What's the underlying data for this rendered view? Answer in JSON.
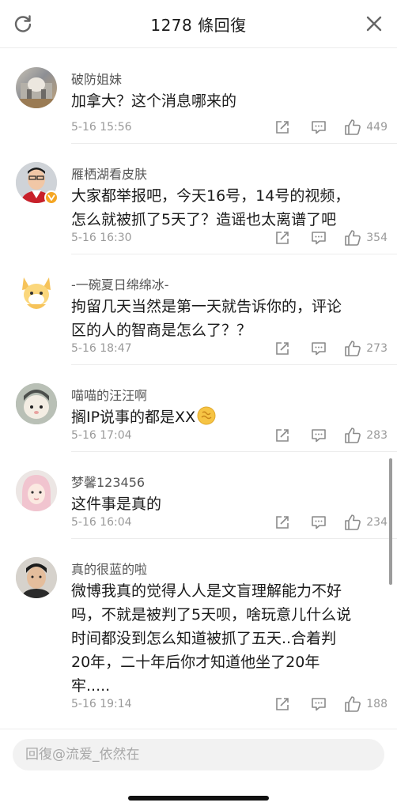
{
  "header": {
    "title": "1278 條回復",
    "refresh_icon": "refresh-icon",
    "close_icon": "close-icon"
  },
  "comments": [
    {
      "username": "破防姐妹",
      "text": "加拿大？这个消息哪来的",
      "time": "5-16 15:56",
      "likes": "449"
    },
    {
      "username": "雁栖湖看皮肤",
      "text": "大家都举报吧，今天16号，14号的视频，\n怎么就被抓了5天了？造谣也太离谱了吧",
      "time": "5-16 16:30",
      "likes": "354",
      "verified": true
    },
    {
      "username": "-一碗夏日绵绵冰-",
      "text": "拘留几天当然是第一天就告诉你的，评论\n区的人的智商是怎么了？？",
      "time": "5-16 18:47",
      "likes": "273"
    },
    {
      "username": "喵喵的汪汪啊",
      "text": "搁IP说事的都是XX",
      "time": "5-16 17:04",
      "likes": "283",
      "emoji": "dizzy-face-emoji"
    },
    {
      "username": "梦馨123456",
      "text": "这件事是真的",
      "time": "5-16 16:04",
      "likes": "234"
    },
    {
      "username": "真的很蓝的啦",
      "text": "微博我真的觉得人人是文盲理解能力不好\n吗，不就是被判了5天呗，啥玩意儿什么说\n时间都没到怎么知道被抓了五天..合着判\n20年，二十年后你才知道他坐了20年\n牢.....",
      "time": "5-16 19:14",
      "likes": "188"
    }
  ],
  "footer": {
    "reply_placeholder": "回復@流爱_依然在"
  },
  "colors": {
    "text_primary": "#1a1a1a",
    "text_secondary": "#9a9a9a",
    "divider": "#ececec",
    "verified_badge": "#f5a623"
  }
}
